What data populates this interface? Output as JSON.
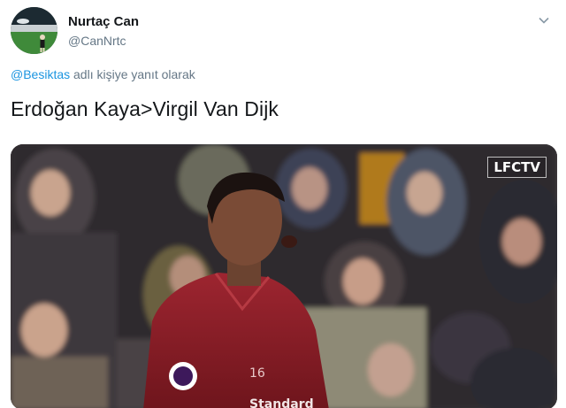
{
  "author": {
    "display_name": "Nurtaç Can",
    "handle": "@CanNrtc"
  },
  "reply_context": {
    "mention": "@Besiktas",
    "suffix": " adlı kişiye yanıt olarak"
  },
  "tweet": {
    "text": "Erdoğan Kaya>Virgil Van Dijk"
  },
  "media": {
    "watermark": "LFCTV",
    "shirt_number": "16",
    "sponsor_text": "Standard"
  },
  "colors": {
    "link": "#1b95e0",
    "muted": "#657786",
    "text": "#14171a",
    "kit_red": "#8e1d24"
  }
}
